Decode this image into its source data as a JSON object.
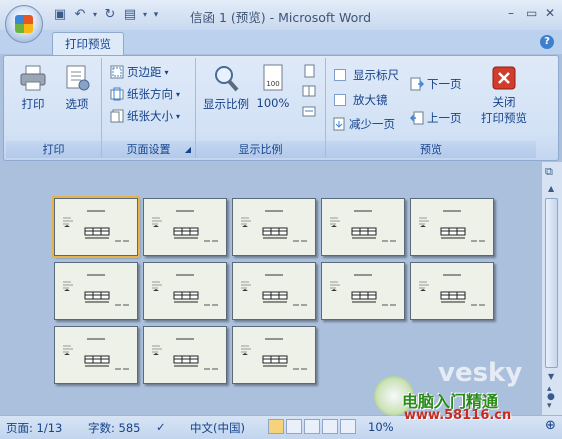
{
  "window": {
    "title": "信函 1 (预览) - Microsoft Word",
    "minimize": "–",
    "restore": "▭",
    "close": "✕"
  },
  "tab": {
    "label": "打印预览"
  },
  "groups": {
    "print": {
      "label": "打印",
      "print_btn": "打印",
      "options_btn": "选项"
    },
    "page_setup": {
      "label": "页面设置",
      "margins": "页边距",
      "orientation": "纸张方向",
      "size": "纸张大小"
    },
    "zoom": {
      "label": "显示比例",
      "zoom_btn": "显示比例",
      "hundred_btn": "100%"
    },
    "preview": {
      "label": "预览",
      "show_ruler": "显示标尺",
      "magnifier": "放大镜",
      "shrink": "减少一页",
      "next_page": "下一页",
      "prev_page": "上一页",
      "close_line1": "关闭",
      "close_line2": "打印预览"
    }
  },
  "pages_count_rendered": 13,
  "statusbar": {
    "page": "页面: 1/13",
    "words": "字数: 585",
    "language": "中文(中国)",
    "zoom": "10%"
  },
  "watermark": {
    "brand": "vesky",
    "text": "电脑入门精通",
    "url": "www.58116.cn"
  },
  "colors": {
    "accent": "#15428b",
    "workspace": "#abc0dc",
    "close_red": "#d23c2c"
  }
}
